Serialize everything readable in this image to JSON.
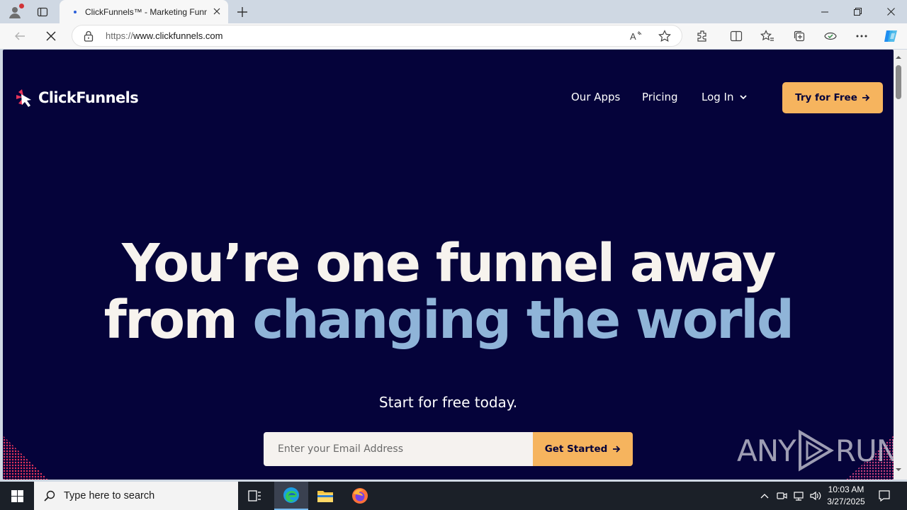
{
  "browser": {
    "tab_title": "ClickFunnels™ - Marketing Funnels",
    "url_protocol": "https://",
    "url_host": "www.clickfunnels.com"
  },
  "site": {
    "brand": "ClickFunnels",
    "nav": {
      "our_apps": "Our Apps",
      "pricing": "Pricing",
      "log_in": "Log In",
      "try_free": "Try for Free"
    },
    "headline_line1": "You’re one funnel away",
    "headline_from": "from ",
    "headline_highlight": "changing the world",
    "subtext": "Start for free today.",
    "email_placeholder": "Enter your Email Address",
    "get_started": "Get Started"
  },
  "watermark": {
    "left": "ANY",
    "right": "RUN"
  },
  "taskbar": {
    "search_placeholder": "Type here to search",
    "time": "10:03 AM",
    "date": "3/27/2025"
  },
  "colors": {
    "page_bg": "#05033a",
    "accent": "#f6b45e",
    "highlight": "#8fb4d8"
  }
}
